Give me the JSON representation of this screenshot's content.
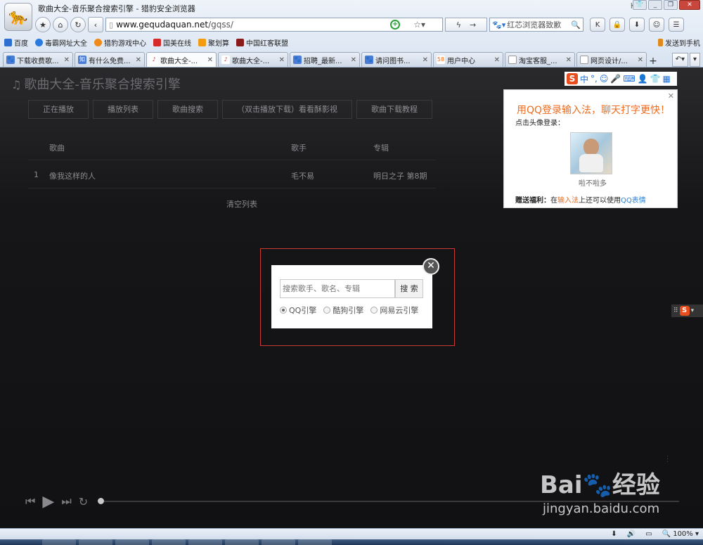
{
  "window": {
    "title": "歌曲大全-音乐聚合搜索引擎 - 猎豹安全浏览器",
    "k_badge": "K"
  },
  "navbar": {
    "url_host": "www.gequdaquan.net",
    "url_path": "/gqss/",
    "search_placeholder": "红芯浏览器致歉"
  },
  "bookmarks": [
    {
      "label": "百度",
      "color": "#2c6fd1"
    },
    {
      "label": "毒霸网址大全",
      "color": "#2a7be0"
    },
    {
      "label": "猎豹游戏中心",
      "color": "#f08a1a"
    },
    {
      "label": "国美在线",
      "color": "#d62a2a"
    },
    {
      "label": "聚划算",
      "color": "#f39c12"
    },
    {
      "label": "中国红客联盟",
      "color": "#8b1a1a"
    }
  ],
  "send_to_phone": "发送到手机",
  "tabs": [
    {
      "label": "下载收费歌...",
      "active": false
    },
    {
      "label": "有什么免费...",
      "active": false
    },
    {
      "label": "歌曲大全-...",
      "active": true
    },
    {
      "label": "歌曲大全-...",
      "active": false
    },
    {
      "label": "招聘_最新...",
      "active": false
    },
    {
      "label": "请问图书...",
      "active": false
    },
    {
      "label": "用户中心",
      "active": false
    },
    {
      "label": "淘宝客服_...",
      "active": false
    },
    {
      "label": "网页设计/...",
      "active": false
    }
  ],
  "page": {
    "site_title": "歌曲大全-音乐聚合搜索引擎",
    "menu": [
      "正在播放",
      "播放列表",
      "歌曲搜索",
      "（双击播放下载）看看酥影视",
      "歌曲下载教程"
    ],
    "columns": {
      "song": "歌曲",
      "singer": "歌手",
      "album": "专辑"
    },
    "rows": [
      {
        "index": "1",
        "song": "像我这样的人",
        "singer": "毛不易",
        "album": "明日之子 第8期"
      }
    ],
    "clear_list": "清空列表"
  },
  "ime": {
    "bar_label": "中",
    "headline": "用QQ登录输入法，聊天打字更快！",
    "sub": "点击头像登录：",
    "nickname": "啦不啦多",
    "gift_prefix": "赠送福利：",
    "gift_mid1": "在",
    "gift_link1": "输入法",
    "gift_mid2": "上还可以使用",
    "gift_link2": "QQ表情"
  },
  "modal": {
    "placeholder": "搜索歌手、歌名、专辑",
    "button": "搜 索",
    "engines": [
      {
        "label": "QQ引擎",
        "selected": true
      },
      {
        "label": "酷狗引擎",
        "selected": false
      },
      {
        "label": "网易云引擎",
        "selected": false
      }
    ]
  },
  "player": {
    "progress": 0
  },
  "watermark": {
    "big": "Bai🐾经验",
    "small": "jingyan.baidu.com"
  },
  "status": {
    "zoom": "100%"
  }
}
